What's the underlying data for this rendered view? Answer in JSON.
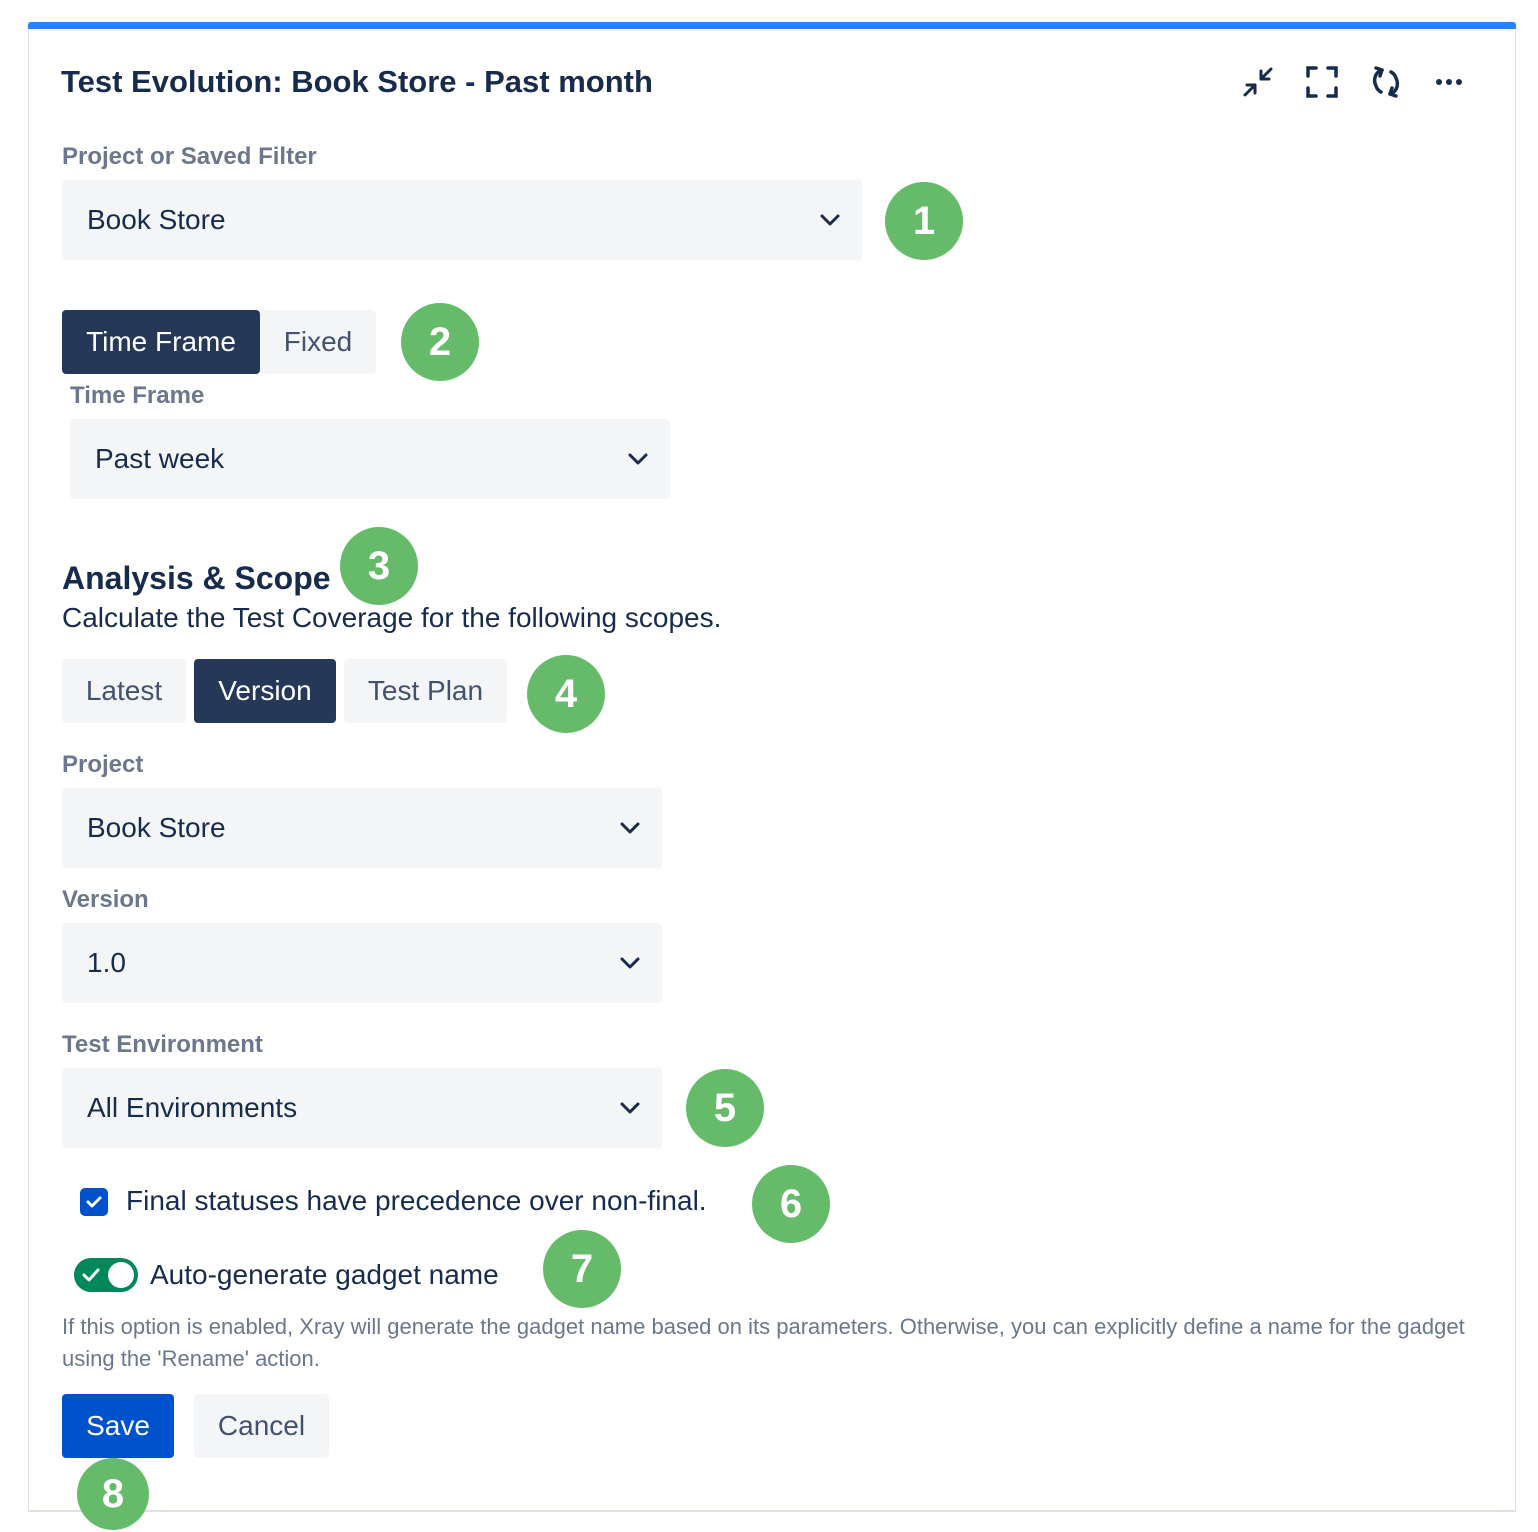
{
  "gadget": {
    "title": "Test Evolution: Book Store - Past month",
    "header_icons": [
      "minimize-icon",
      "fullscreen-icon",
      "refresh-icon",
      "more-icon"
    ]
  },
  "filter": {
    "label": "Project or Saved Filter",
    "value": "Book Store"
  },
  "time_mode": {
    "options": [
      "Time Frame",
      "Fixed"
    ],
    "selected": "Time Frame"
  },
  "time_frame": {
    "label": "Time Frame",
    "value": "Past week"
  },
  "analysis": {
    "heading": "Analysis & Scope",
    "description": "Calculate the Test Coverage for the following scopes.",
    "scopes": [
      "Latest",
      "Version",
      "Test Plan"
    ],
    "selected_scope": "Version"
  },
  "project": {
    "label": "Project",
    "value": "Book Store"
  },
  "version": {
    "label": "Version",
    "value": "1.0"
  },
  "environment": {
    "label": "Test Environment",
    "value": "All Environments"
  },
  "final_statuses": {
    "label": "Final statuses have precedence over non-final.",
    "checked": true
  },
  "auto_name": {
    "label": "Auto-generate gadget name",
    "enabled": true,
    "help": "If this option is enabled, Xray will generate the gadget name based on its parameters. Otherwise, you can explicitly define a name for the gadget using the 'Rename' action."
  },
  "actions": {
    "save": "Save",
    "cancel": "Cancel"
  },
  "callouts": [
    "1",
    "2",
    "3",
    "4",
    "5",
    "6",
    "7",
    "8"
  ],
  "colors": {
    "accent_bar": "#2684ff",
    "primary_button": "#0052cc",
    "selected_segment": "#253858",
    "callout": "#66bb6a",
    "toggle_on": "#00875a"
  }
}
